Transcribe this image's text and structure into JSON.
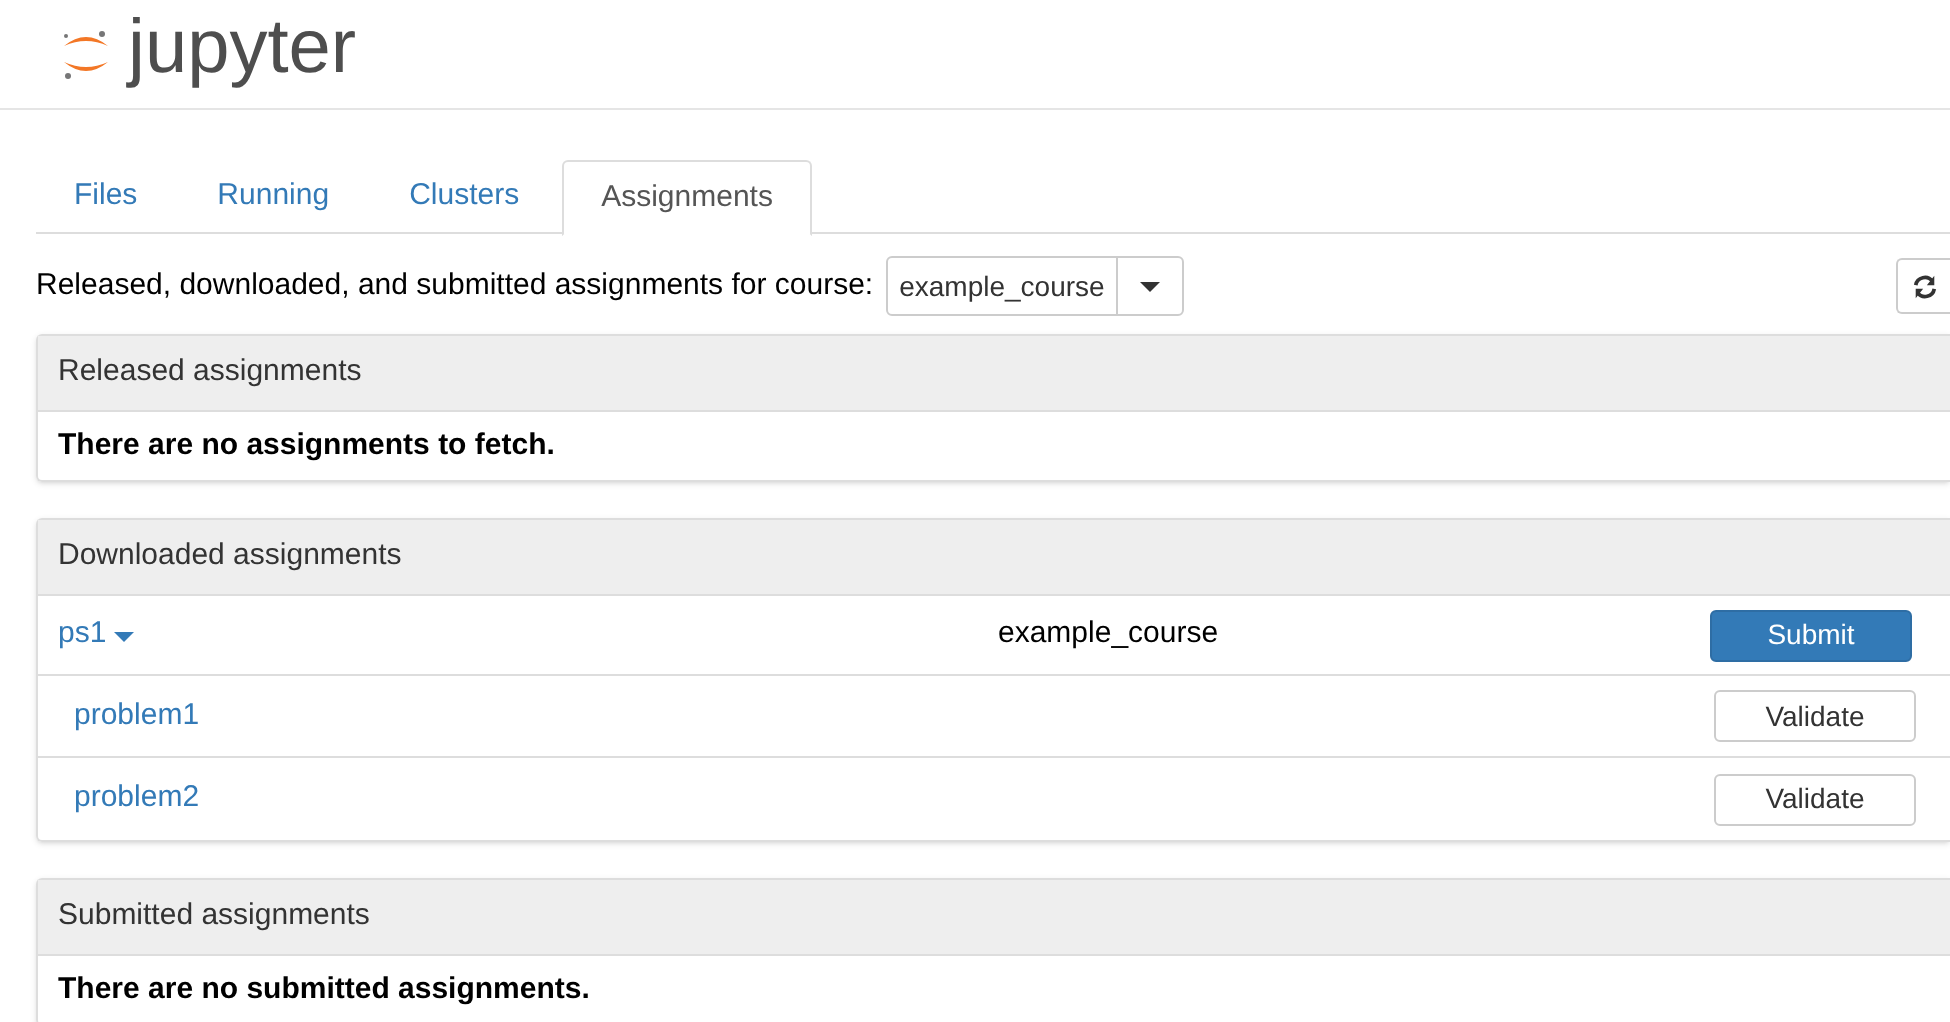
{
  "logo": {
    "text": "jupyter"
  },
  "tabs": [
    {
      "label": "Files",
      "selected": false
    },
    {
      "label": "Running",
      "selected": false
    },
    {
      "label": "Clusters",
      "selected": false
    },
    {
      "label": "Assignments",
      "selected": true
    }
  ],
  "course_bar": {
    "label": "Released, downloaded, and submitted assignments for course:",
    "course": "example_course"
  },
  "panels": [
    {
      "kind": "message",
      "title": "Released assignments",
      "message": "There are no assignments to fetch."
    },
    {
      "kind": "assignments",
      "title": "Downloaded assignments",
      "assignments": [
        {
          "name": "ps1",
          "expanded": true,
          "course": "example_course",
          "action": "Submit",
          "problems": [
            {
              "name": "problem1",
              "action": "Validate"
            },
            {
              "name": "problem2",
              "action": "Validate"
            }
          ]
        }
      ]
    },
    {
      "kind": "message",
      "title": "Submitted assignments",
      "message": "There are no submitted assignments."
    }
  ]
}
